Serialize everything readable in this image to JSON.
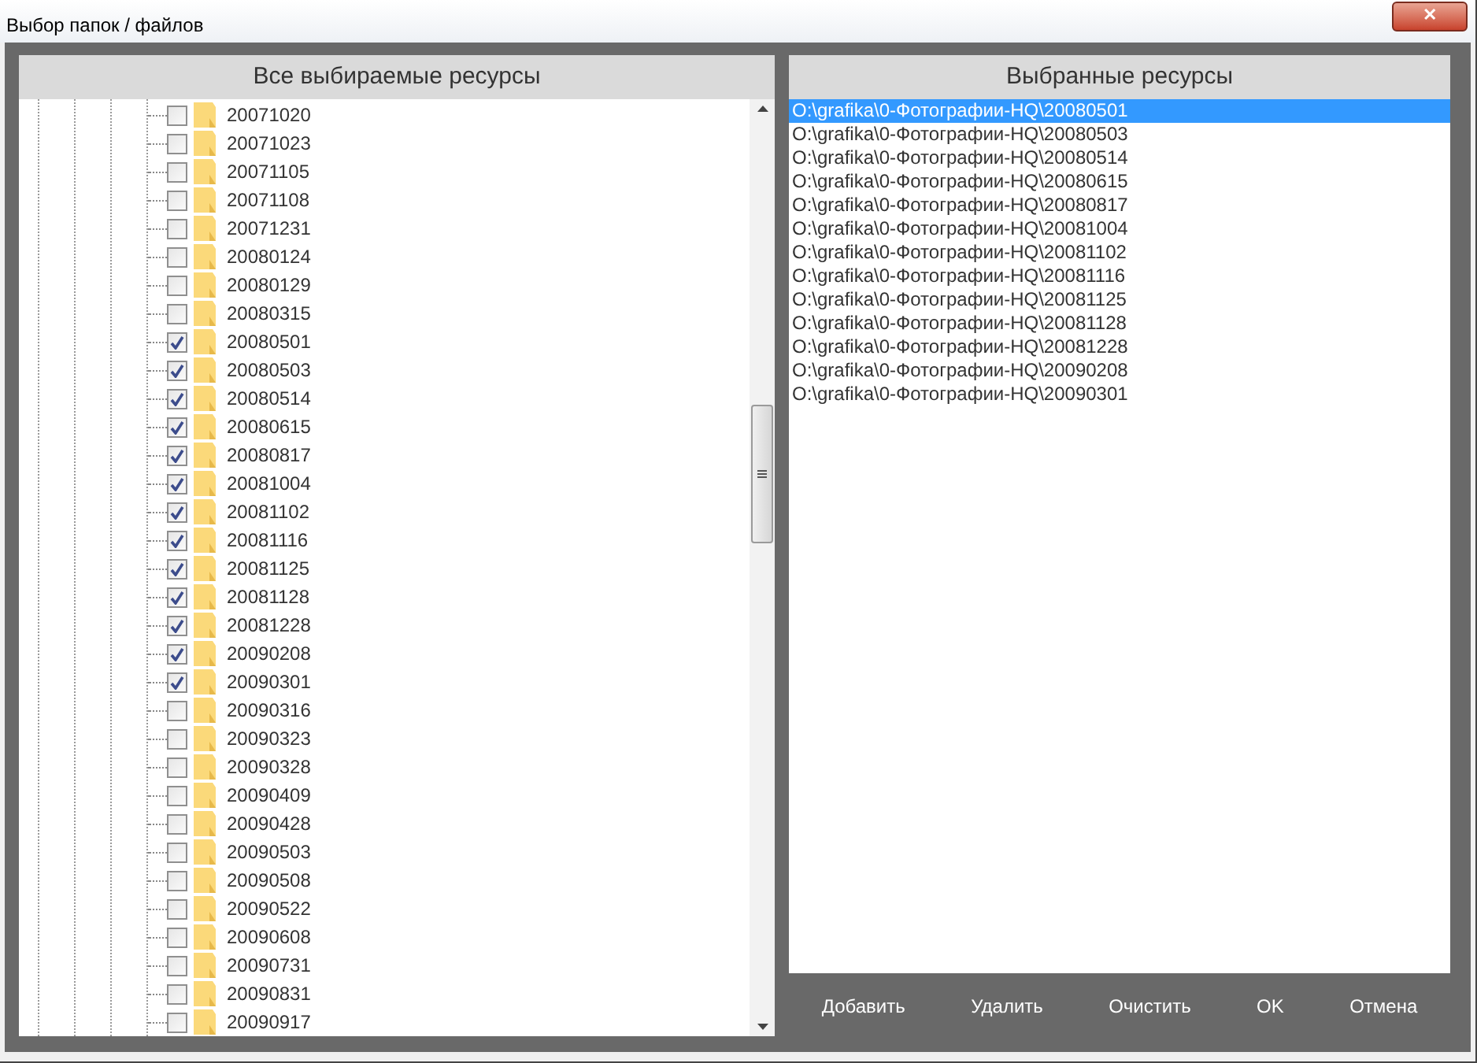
{
  "window": {
    "title": "Выбор папок / файлов",
    "close": "✕"
  },
  "tree": {
    "title": "Все выбираемые ресурсы",
    "items": [
      {
        "label": "20071020",
        "checked": false
      },
      {
        "label": "20071023",
        "checked": false
      },
      {
        "label": "20071105",
        "checked": false
      },
      {
        "label": "20071108",
        "checked": false
      },
      {
        "label": "20071231",
        "checked": false
      },
      {
        "label": "20080124",
        "checked": false
      },
      {
        "label": "20080129",
        "checked": false
      },
      {
        "label": "20080315",
        "checked": false
      },
      {
        "label": "20080501",
        "checked": true
      },
      {
        "label": "20080503",
        "checked": true
      },
      {
        "label": "20080514",
        "checked": true
      },
      {
        "label": "20080615",
        "checked": true
      },
      {
        "label": "20080817",
        "checked": true
      },
      {
        "label": "20081004",
        "checked": true
      },
      {
        "label": "20081102",
        "checked": true
      },
      {
        "label": "20081116",
        "checked": true
      },
      {
        "label": "20081125",
        "checked": true
      },
      {
        "label": "20081128",
        "checked": true
      },
      {
        "label": "20081228",
        "checked": true
      },
      {
        "label": "20090208",
        "checked": true
      },
      {
        "label": "20090301",
        "checked": true
      },
      {
        "label": "20090316",
        "checked": false
      },
      {
        "label": "20090323",
        "checked": false
      },
      {
        "label": "20090328",
        "checked": false
      },
      {
        "label": "20090409",
        "checked": false
      },
      {
        "label": "20090428",
        "checked": false
      },
      {
        "label": "20090503",
        "checked": false
      },
      {
        "label": "20090508",
        "checked": false
      },
      {
        "label": "20090522",
        "checked": false
      },
      {
        "label": "20090608",
        "checked": false
      },
      {
        "label": "20090731",
        "checked": false
      },
      {
        "label": "20090831",
        "checked": false
      },
      {
        "label": "20090917",
        "checked": false
      }
    ]
  },
  "selected_list": {
    "title": "Выбранные ресурсы",
    "items": [
      {
        "label": "O:\\grafika\\0-Фотографии-HQ\\20080501",
        "selected": true
      },
      {
        "label": "O:\\grafika\\0-Фотографии-HQ\\20080503",
        "selected": false
      },
      {
        "label": "O:\\grafika\\0-Фотографии-HQ\\20080514",
        "selected": false
      },
      {
        "label": "O:\\grafika\\0-Фотографии-HQ\\20080615",
        "selected": false
      },
      {
        "label": "O:\\grafika\\0-Фотографии-HQ\\20080817",
        "selected": false
      },
      {
        "label": "O:\\grafika\\0-Фотографии-HQ\\20081004",
        "selected": false
      },
      {
        "label": "O:\\grafika\\0-Фотографии-HQ\\20081102",
        "selected": false
      },
      {
        "label": "O:\\grafika\\0-Фотографии-HQ\\20081116",
        "selected": false
      },
      {
        "label": "O:\\grafika\\0-Фотографии-HQ\\20081125",
        "selected": false
      },
      {
        "label": "O:\\grafika\\0-Фотографии-HQ\\20081128",
        "selected": false
      },
      {
        "label": "O:\\grafika\\0-Фотографии-HQ\\20081228",
        "selected": false
      },
      {
        "label": "O:\\grafika\\0-Фотографии-HQ\\20090208",
        "selected": false
      },
      {
        "label": "O:\\grafika\\0-Фотографии-HQ\\20090301",
        "selected": false
      }
    ]
  },
  "buttons": [
    "Добавить",
    "Удалить",
    "Очистить",
    "OK",
    "Отмена"
  ]
}
